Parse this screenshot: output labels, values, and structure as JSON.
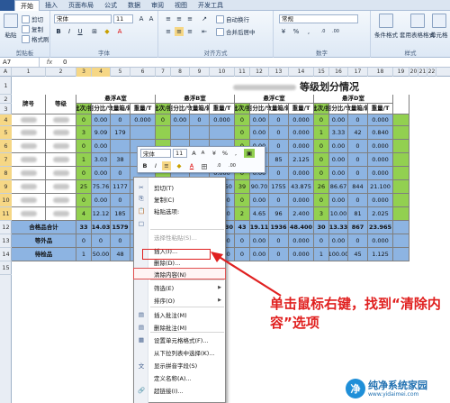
{
  "menubar": {
    "tabs": [
      "开始",
      "插入",
      "页面布局",
      "公式",
      "数据",
      "审阅",
      "视图",
      "开发工具"
    ],
    "active": 0
  },
  "ribbon": {
    "clipboard": {
      "paste": "粘贴",
      "cut": "剪切",
      "copy": "复制",
      "format_painter": "格式刷",
      "label": "剪贴板"
    },
    "font": {
      "name": "宋体",
      "size": "11",
      "bold": "B",
      "italic": "I",
      "underline": "U",
      "label": "字体"
    },
    "alignment": {
      "wrap": "自动换行",
      "merge": "合并后居中",
      "label": "对齐方式"
    },
    "number": {
      "format": "常规",
      "label": "数字"
    },
    "styles": {
      "conditional": "条件格式",
      "table": "套用表格格式",
      "cell": "单元格",
      "label": "样式"
    }
  },
  "formula": {
    "namebox": "A7",
    "fx": "fx",
    "value": "0"
  },
  "columns": [
    "A",
    "1",
    "2",
    "3",
    "4",
    "5",
    "6",
    "7",
    "8",
    "9",
    "10",
    "11",
    "12",
    "13",
    "14",
    "15",
    "16",
    "17",
    "18",
    "19",
    "20",
    "21",
    "22"
  ],
  "rows": [
    "1",
    "2",
    "3",
    "4",
    "5",
    "6",
    "7",
    "8",
    "9",
    "10",
    "11",
    "12",
    "13",
    "14",
    "15"
  ],
  "title": "等级划分情况",
  "headers": {
    "brand": "牌号",
    "grade": "等级",
    "groups": [
      "悬浮A室",
      "悬浮B室",
      "悬浮C室",
      "悬浮D室"
    ],
    "sub": [
      "批次/批",
      "百分比/%",
      "数量箱/箱",
      "重量/T"
    ]
  },
  "table_rows": [
    {
      "r": "4",
      "a": [
        "0",
        "0.00",
        "0",
        "0.000"
      ],
      "b": [
        "0",
        "0.00",
        "0",
        "0.000"
      ],
      "c": [
        "0",
        "0.00",
        "0",
        "0.000"
      ],
      "d": [
        "0",
        "0.00",
        "0",
        "0.000"
      ]
    },
    {
      "r": "5",
      "a": [
        "3",
        "9.09",
        "179",
        ""
      ],
      "b": [
        "",
        "",
        "",
        ""
      ],
      "c": [
        "0",
        "0.00",
        "0",
        "0.000"
      ],
      "d": [
        "1",
        "3.33",
        "42",
        "0.840"
      ]
    },
    {
      "r": "6",
      "a": [
        "0",
        "0.00",
        "",
        ""
      ],
      "b": [
        "",
        "",
        "",
        ""
      ],
      "c": [
        "0",
        "0.00",
        "0",
        "0.000"
      ],
      "d": [
        "0",
        "0.00",
        "0",
        "0.000"
      ]
    },
    {
      "r": "7",
      "a": [
        "1",
        "3.03",
        "38",
        ""
      ],
      "b": [
        "",
        "",
        "",
        "8.300"
      ],
      "c": [
        "2",
        "4.65",
        "85",
        "2.125"
      ],
      "d": [
        "0",
        "0.00",
        "0",
        "0.000"
      ]
    },
    {
      "r": "8",
      "a": [
        "0",
        "0.00",
        "0",
        ""
      ],
      "b": [
        "",
        "",
        "",
        "0.000"
      ],
      "c": [
        "0",
        "0.00",
        "0",
        "0.000"
      ],
      "d": [
        "0",
        "0.00",
        "0",
        "0.000"
      ]
    },
    {
      "r": "9",
      "a": [
        "25",
        "75.76",
        "1177",
        ""
      ],
      "b": [
        "",
        "",
        "",
        "27.150"
      ],
      "c": [
        "39",
        "90.70",
        "1755",
        "43.875"
      ],
      "d": [
        "26",
        "86.67",
        "844",
        "21.100"
      ]
    },
    {
      "r": "10",
      "a": [
        "0",
        "0.00",
        "0",
        ""
      ],
      "b": [
        "",
        "",
        "",
        "0.000"
      ],
      "c": [
        "0",
        "0.00",
        "0",
        "0.000"
      ],
      "d": [
        "0",
        "0.00",
        "0",
        "0.000"
      ]
    },
    {
      "r": "11",
      "a": [
        "4",
        "12.12",
        "185",
        ""
      ],
      "b": [
        "",
        "",
        "",
        "3.280"
      ],
      "c": [
        "2",
        "4.65",
        "96",
        "2.400"
      ],
      "d": [
        "3",
        "10.00",
        "81",
        "2.025"
      ]
    }
  ],
  "total_row": {
    "label": "合格品合计",
    "r": "12",
    "a": [
      "33",
      "14.03",
      "1579",
      ""
    ],
    "b": [
      "",
      "",
      "",
      "38.730"
    ],
    "c": [
      "43",
      "19.11",
      "1936",
      "48.400"
    ],
    "d": [
      "30",
      "13.33",
      "867",
      "23.965"
    ]
  },
  "equal_row": {
    "label": "等外品",
    "r": "13",
    "a": [
      "0",
      "0",
      "0",
      ""
    ],
    "b": [
      "",
      "",
      "",
      "0.000"
    ],
    "c": [
      "0",
      "0.00",
      "0",
      "0.000"
    ],
    "d": [
      "0",
      "0.00",
      "0",
      "0.000"
    ]
  },
  "pending_row": {
    "label": "待检品",
    "r": "14",
    "a": [
      "1",
      "50.00",
      "48",
      ""
    ],
    "b": [
      "",
      "",
      "",
      "0.000"
    ],
    "c": [
      "0",
      "0.00",
      "0",
      "0.000"
    ],
    "d": [
      "1",
      "100.00",
      "45",
      "1.125"
    ]
  },
  "mini_toolbar": {
    "font": "宋体",
    "size": "11",
    "grow": "A",
    "shrink": "A",
    "currency": "¥",
    "percent": "%",
    "comma": ",",
    "bold": "B",
    "italic": "I",
    "fill": "A",
    "border": "田",
    "dec_inc": ".0",
    "dec_dec": ".00"
  },
  "context_menu": [
    {
      "label": "剪切(T)",
      "icon": "✂"
    },
    {
      "label": "复制(C)",
      "icon": "⎘"
    },
    {
      "label": "粘贴选项:",
      "icon": "📋"
    },
    {
      "label": "",
      "icon": "□"
    },
    {
      "label": "选择性粘贴(S)...",
      "icon": "",
      "disabled": true
    },
    {
      "label": "插入(I)...",
      "icon": ""
    },
    {
      "label": "删除(D)...",
      "icon": ""
    },
    {
      "label": "清除内容(N)",
      "icon": "",
      "highlight": true
    },
    {
      "label": "筛选(E)",
      "icon": "",
      "arrow": true
    },
    {
      "label": "排序(O)",
      "icon": "",
      "arrow": true
    },
    {
      "label": "插入批注(M)",
      "icon": "▤"
    },
    {
      "label": "删除批注(M)",
      "icon": "▤"
    },
    {
      "label": "设置单元格格式(F)...",
      "icon": "▦"
    },
    {
      "label": "从下拉列表中选择(K)...",
      "icon": ""
    },
    {
      "label": "显示拼音字段(S)",
      "icon": "文"
    },
    {
      "label": "定义名称(A)...",
      "icon": ""
    },
    {
      "label": "超链接(I)...",
      "icon": "🔗"
    }
  ],
  "callout": "单击鼠标右键，找到“清除内容”选项",
  "watermark": {
    "name": "纯净系统家园",
    "url": "www.yidaimei.com"
  }
}
